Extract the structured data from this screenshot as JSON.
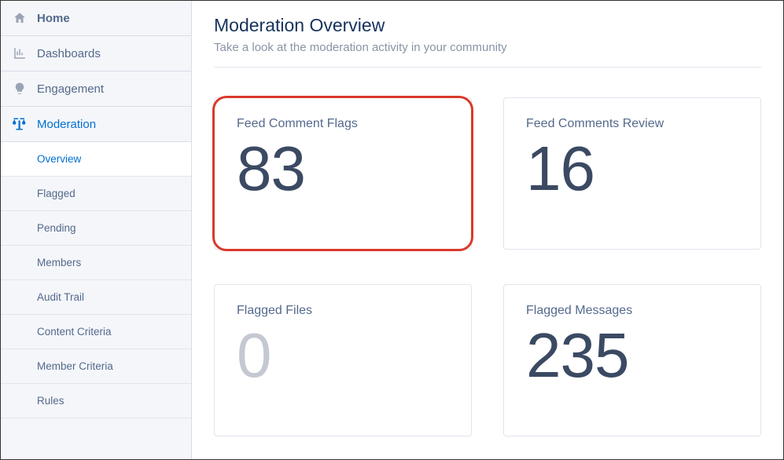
{
  "sidebar": {
    "items": [
      {
        "label": "Home"
      },
      {
        "label": "Dashboards"
      },
      {
        "label": "Engagement"
      },
      {
        "label": "Moderation"
      }
    ],
    "subitems": [
      {
        "label": "Overview"
      },
      {
        "label": "Flagged"
      },
      {
        "label": "Pending"
      },
      {
        "label": "Members"
      },
      {
        "label": "Audit Trail"
      },
      {
        "label": "Content Criteria"
      },
      {
        "label": "Member Criteria"
      },
      {
        "label": "Rules"
      }
    ]
  },
  "main": {
    "title": "Moderation Overview",
    "subtitle": "Take a look at the moderation activity in your community",
    "cards": [
      {
        "title": "Feed Comment Flags",
        "value": "83"
      },
      {
        "title": "Feed Comments Review",
        "value": "16"
      },
      {
        "title": "Flagged Files",
        "value": "0"
      },
      {
        "title": "Flagged Messages",
        "value": "235"
      }
    ]
  }
}
